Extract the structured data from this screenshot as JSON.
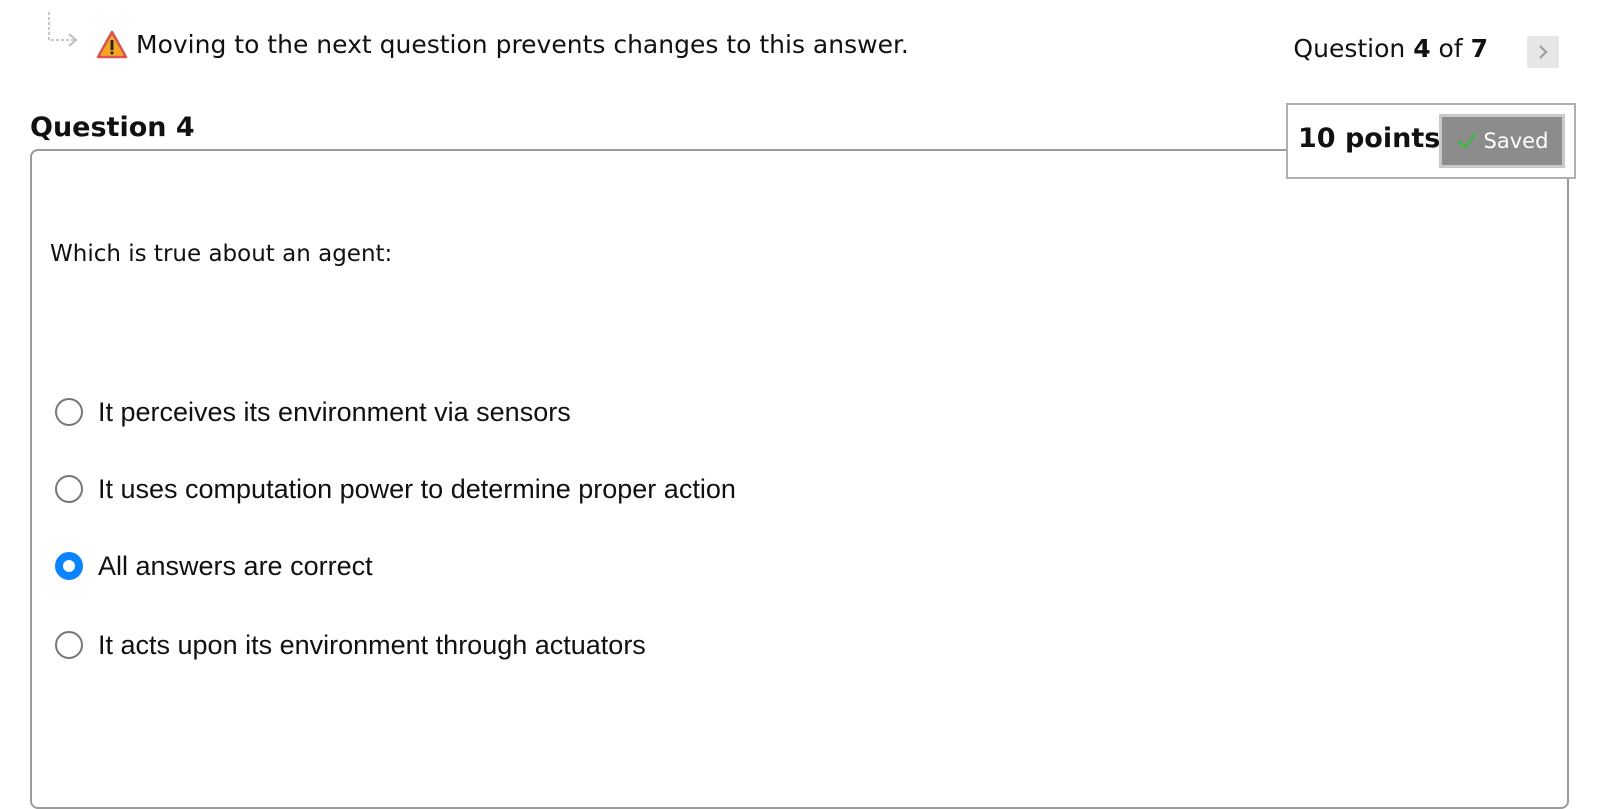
{
  "warning": {
    "icon": "warning-triangle-icon",
    "text": "Moving to the next question prevents changes to this answer."
  },
  "counter": {
    "prefix": "Question ",
    "current": "4",
    "middle": " of ",
    "total": "7",
    "next_icon": "chevron-right-icon"
  },
  "question": {
    "title": "Question 4",
    "points": "10 points",
    "saved_label": "Saved",
    "saved_icon": "checkmark-icon",
    "prompt": "Which is true about an agent:",
    "options": [
      {
        "label": "It perceives its environment via sensors",
        "selected": false
      },
      {
        "label": "It uses computation power to determine proper action",
        "selected": false
      },
      {
        "label": "All answers are correct",
        "selected": true
      },
      {
        "label": "It acts upon its environment through actuators",
        "selected": false
      }
    ]
  },
  "colors": {
    "selected_radio": "#0a84ff",
    "warning_orange": "#f5a623",
    "saved_badge": "#8c8c8c",
    "check_green": "#4caf50"
  }
}
